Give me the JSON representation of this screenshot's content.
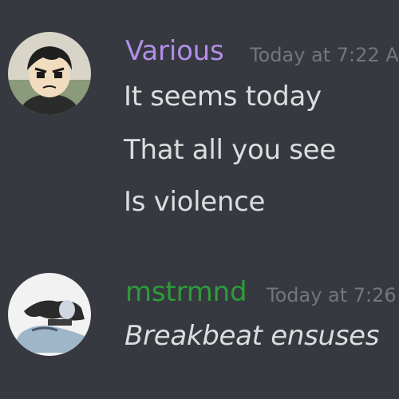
{
  "messages": [
    {
      "author": "Various",
      "author_color": "#b38ee8",
      "timestamp": "Today at 7:22 A",
      "avatar_icon": "avatar-cartoon-boy-icon",
      "lines": [
        "It seems today",
        "That all you see",
        "Is violence"
      ]
    },
    {
      "author": "mstrmnd",
      "author_color": "#2e9c3a",
      "timestamp": "Today at 7:26",
      "avatar_icon": "avatar-reclining-figure-icon",
      "lines": [
        "Breakbeat ensuses"
      ]
    }
  ]
}
